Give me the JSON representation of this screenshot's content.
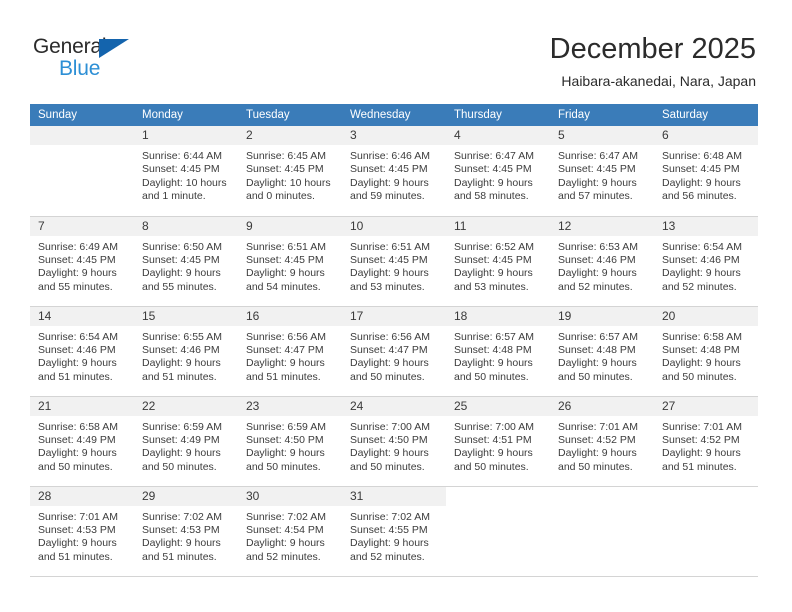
{
  "brand": {
    "name_part1": "General",
    "name_part2": "Blue",
    "triangle_icon": "triangle-icon",
    "colors": {
      "dark": "#2b2b2b",
      "blue": "#2d8fd5",
      "triangle": "#1464ad"
    }
  },
  "header": {
    "title": "December 2025",
    "subtitle": "Haibara-akanedai, Nara, Japan"
  },
  "calendar": {
    "accent_color": "#3a7cb9",
    "daynum_bg": "#f1f1f1",
    "weekday_headers": [
      "Sunday",
      "Monday",
      "Tuesday",
      "Wednesday",
      "Thursday",
      "Friday",
      "Saturday"
    ],
    "weeks": [
      [
        {
          "day": "",
          "empty": true
        },
        {
          "day": "1",
          "sunrise": "Sunrise: 6:44 AM",
          "sunset": "Sunset: 4:45 PM",
          "daylight_line1": "Daylight: 10 hours",
          "daylight_line2": "and 1 minute."
        },
        {
          "day": "2",
          "sunrise": "Sunrise: 6:45 AM",
          "sunset": "Sunset: 4:45 PM",
          "daylight_line1": "Daylight: 10 hours",
          "daylight_line2": "and 0 minutes."
        },
        {
          "day": "3",
          "sunrise": "Sunrise: 6:46 AM",
          "sunset": "Sunset: 4:45 PM",
          "daylight_line1": "Daylight: 9 hours",
          "daylight_line2": "and 59 minutes."
        },
        {
          "day": "4",
          "sunrise": "Sunrise: 6:47 AM",
          "sunset": "Sunset: 4:45 PM",
          "daylight_line1": "Daylight: 9 hours",
          "daylight_line2": "and 58 minutes."
        },
        {
          "day": "5",
          "sunrise": "Sunrise: 6:47 AM",
          "sunset": "Sunset: 4:45 PM",
          "daylight_line1": "Daylight: 9 hours",
          "daylight_line2": "and 57 minutes."
        },
        {
          "day": "6",
          "sunrise": "Sunrise: 6:48 AM",
          "sunset": "Sunset: 4:45 PM",
          "daylight_line1": "Daylight: 9 hours",
          "daylight_line2": "and 56 minutes."
        }
      ],
      [
        {
          "day": "7",
          "sunrise": "Sunrise: 6:49 AM",
          "sunset": "Sunset: 4:45 PM",
          "daylight_line1": "Daylight: 9 hours",
          "daylight_line2": "and 55 minutes."
        },
        {
          "day": "8",
          "sunrise": "Sunrise: 6:50 AM",
          "sunset": "Sunset: 4:45 PM",
          "daylight_line1": "Daylight: 9 hours",
          "daylight_line2": "and 55 minutes."
        },
        {
          "day": "9",
          "sunrise": "Sunrise: 6:51 AM",
          "sunset": "Sunset: 4:45 PM",
          "daylight_line1": "Daylight: 9 hours",
          "daylight_line2": "and 54 minutes."
        },
        {
          "day": "10",
          "sunrise": "Sunrise: 6:51 AM",
          "sunset": "Sunset: 4:45 PM",
          "daylight_line1": "Daylight: 9 hours",
          "daylight_line2": "and 53 minutes."
        },
        {
          "day": "11",
          "sunrise": "Sunrise: 6:52 AM",
          "sunset": "Sunset: 4:45 PM",
          "daylight_line1": "Daylight: 9 hours",
          "daylight_line2": "and 53 minutes."
        },
        {
          "day": "12",
          "sunrise": "Sunrise: 6:53 AM",
          "sunset": "Sunset: 4:46 PM",
          "daylight_line1": "Daylight: 9 hours",
          "daylight_line2": "and 52 minutes."
        },
        {
          "day": "13",
          "sunrise": "Sunrise: 6:54 AM",
          "sunset": "Sunset: 4:46 PM",
          "daylight_line1": "Daylight: 9 hours",
          "daylight_line2": "and 52 minutes."
        }
      ],
      [
        {
          "day": "14",
          "sunrise": "Sunrise: 6:54 AM",
          "sunset": "Sunset: 4:46 PM",
          "daylight_line1": "Daylight: 9 hours",
          "daylight_line2": "and 51 minutes."
        },
        {
          "day": "15",
          "sunrise": "Sunrise: 6:55 AM",
          "sunset": "Sunset: 4:46 PM",
          "daylight_line1": "Daylight: 9 hours",
          "daylight_line2": "and 51 minutes."
        },
        {
          "day": "16",
          "sunrise": "Sunrise: 6:56 AM",
          "sunset": "Sunset: 4:47 PM",
          "daylight_line1": "Daylight: 9 hours",
          "daylight_line2": "and 51 minutes."
        },
        {
          "day": "17",
          "sunrise": "Sunrise: 6:56 AM",
          "sunset": "Sunset: 4:47 PM",
          "daylight_line1": "Daylight: 9 hours",
          "daylight_line2": "and 50 minutes."
        },
        {
          "day": "18",
          "sunrise": "Sunrise: 6:57 AM",
          "sunset": "Sunset: 4:48 PM",
          "daylight_line1": "Daylight: 9 hours",
          "daylight_line2": "and 50 minutes."
        },
        {
          "day": "19",
          "sunrise": "Sunrise: 6:57 AM",
          "sunset": "Sunset: 4:48 PM",
          "daylight_line1": "Daylight: 9 hours",
          "daylight_line2": "and 50 minutes."
        },
        {
          "day": "20",
          "sunrise": "Sunrise: 6:58 AM",
          "sunset": "Sunset: 4:48 PM",
          "daylight_line1": "Daylight: 9 hours",
          "daylight_line2": "and 50 minutes."
        }
      ],
      [
        {
          "day": "21",
          "sunrise": "Sunrise: 6:58 AM",
          "sunset": "Sunset: 4:49 PM",
          "daylight_line1": "Daylight: 9 hours",
          "daylight_line2": "and 50 minutes."
        },
        {
          "day": "22",
          "sunrise": "Sunrise: 6:59 AM",
          "sunset": "Sunset: 4:49 PM",
          "daylight_line1": "Daylight: 9 hours",
          "daylight_line2": "and 50 minutes."
        },
        {
          "day": "23",
          "sunrise": "Sunrise: 6:59 AM",
          "sunset": "Sunset: 4:50 PM",
          "daylight_line1": "Daylight: 9 hours",
          "daylight_line2": "and 50 minutes."
        },
        {
          "day": "24",
          "sunrise": "Sunrise: 7:00 AM",
          "sunset": "Sunset: 4:50 PM",
          "daylight_line1": "Daylight: 9 hours",
          "daylight_line2": "and 50 minutes."
        },
        {
          "day": "25",
          "sunrise": "Sunrise: 7:00 AM",
          "sunset": "Sunset: 4:51 PM",
          "daylight_line1": "Daylight: 9 hours",
          "daylight_line2": "and 50 minutes."
        },
        {
          "day": "26",
          "sunrise": "Sunrise: 7:01 AM",
          "sunset": "Sunset: 4:52 PM",
          "daylight_line1": "Daylight: 9 hours",
          "daylight_line2": "and 50 minutes."
        },
        {
          "day": "27",
          "sunrise": "Sunrise: 7:01 AM",
          "sunset": "Sunset: 4:52 PM",
          "daylight_line1": "Daylight: 9 hours",
          "daylight_line2": "and 51 minutes."
        }
      ],
      [
        {
          "day": "28",
          "sunrise": "Sunrise: 7:01 AM",
          "sunset": "Sunset: 4:53 PM",
          "daylight_line1": "Daylight: 9 hours",
          "daylight_line2": "and 51 minutes."
        },
        {
          "day": "29",
          "sunrise": "Sunrise: 7:02 AM",
          "sunset": "Sunset: 4:53 PM",
          "daylight_line1": "Daylight: 9 hours",
          "daylight_line2": "and 51 minutes."
        },
        {
          "day": "30",
          "sunrise": "Sunrise: 7:02 AM",
          "sunset": "Sunset: 4:54 PM",
          "daylight_line1": "Daylight: 9 hours",
          "daylight_line2": "and 52 minutes."
        },
        {
          "day": "31",
          "sunrise": "Sunrise: 7:02 AM",
          "sunset": "Sunset: 4:55 PM",
          "daylight_line1": "Daylight: 9 hours",
          "daylight_line2": "and 52 minutes."
        },
        {
          "day": "",
          "blank": true
        },
        {
          "day": "",
          "blank": true
        },
        {
          "day": "",
          "blank": true
        }
      ]
    ]
  }
}
